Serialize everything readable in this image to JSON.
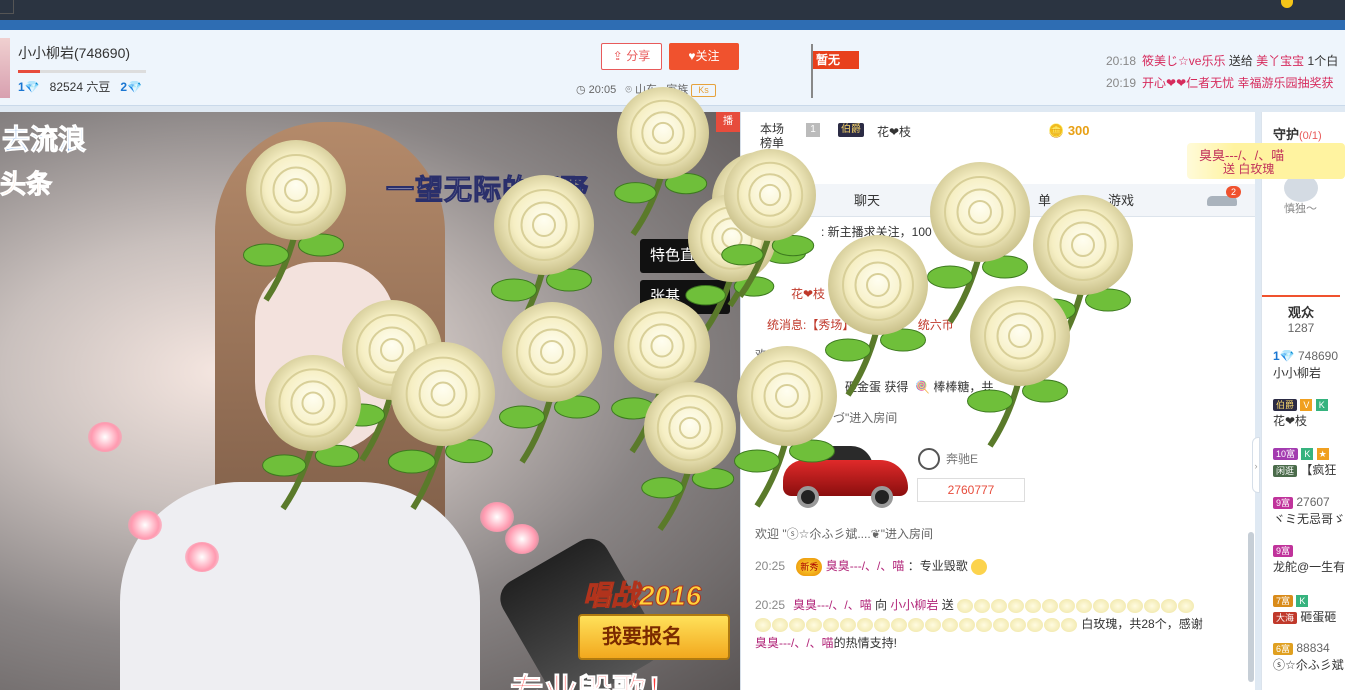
{
  "topnav": {
    "left_item1": "",
    "left_item2": "",
    "right_item": ""
  },
  "anchor": {
    "name": "小小柳岩(748690)",
    "level": "1",
    "beans": "82524 六豆",
    "next_level": "2"
  },
  "actions": {
    "share": "分享",
    "follow": "关注"
  },
  "meta": {
    "time": "20:05",
    "location": "山东",
    "family_label": "家族",
    "family_tag": "Ks"
  },
  "flag": {
    "label": "暂无"
  },
  "gift_feed": [
    {
      "time": "20:18",
      "from": "筱美じ☆ve乐乐",
      "verb": "送给",
      "to": "美丫宝宝",
      "gift": "1个白"
    },
    {
      "time": "20:19",
      "from": "开心❤❤仁者无忧",
      "verb": "",
      "to": "幸福游乐园抽奖获",
      "gift": ""
    }
  ],
  "video": {
    "song_prefix": "一望无际的",
    "song_blue": "原野",
    "tl_badge": "去流浪",
    "tl_badge2": "头条",
    "tag_special": "特色直播",
    "tag_other": "张基",
    "red_corner": "播",
    "changzhan": "唱战2016",
    "signup": "我要报名",
    "bottom_text": "专业毁歌！"
  },
  "rank": {
    "label": "本场榜单",
    "num": "1",
    "badge": "伯爵",
    "name": "花❤枝",
    "coins": "300"
  },
  "tabs": {
    "chat": "聊天",
    "list": "单",
    "game": "游戏",
    "badge": "2"
  },
  "chat": {
    "msg1": ": 新主播求关注，100",
    "msg2": "花❤枝",
    "msg3": "统消息:【秀场】",
    "msg3b": "统六币",
    "msg4": "欢迎",
    "msg5": "砸金蛋 获得",
    "msg5b": "棒棒糖，共",
    "msg6": "ゞづ\"进入房间",
    "car_brand": "奔驰E",
    "car_id": "2760777",
    "welcome": "欢迎 \"ⓢ☆尒ふ彡斌....❦\"进入房间",
    "m1_time": "20:25",
    "m1_user": "臭臭---/、/、喵",
    "m1_text": "：专业毁歌",
    "new_badge": "新秀",
    "m2_time": "20:25",
    "m2_user": "臭臭---/、/、喵",
    "m2_verb": "向",
    "m2_target": "小小柳岩",
    "m2_send": "送",
    "m2_gift": "白玫瑰，共28个，感谢",
    "m2_user2": "臭臭---/、/、喵",
    "m2_tail": "的热情支持!"
  },
  "right": {
    "guard_label": "守护",
    "guard_count": "(0/1)",
    "guard_name": "慎独～",
    "audience_label": "观众",
    "audience_count": "1287",
    "items": [
      {
        "badge": "1",
        "num": "748690",
        "name": "小小柳岩"
      },
      {
        "badge": "伯爵",
        "extra": "V",
        "name": "花❤枝"
      },
      {
        "badge": "10富",
        "tag": "闲逛",
        "name": "【疯狂"
      },
      {
        "badge": "9富",
        "num": "27607",
        "name": "ヾミ无忌哥ゞ"
      },
      {
        "badge": "9富",
        "name": "龙舵@一生有"
      },
      {
        "badge": "7富",
        "tag": "大海",
        "name": "砸蛋砸"
      },
      {
        "badge": "6富",
        "num": "88834",
        "name": "ⓢ☆尒ふ彡斌"
      }
    ]
  },
  "gift_popup": {
    "name": "臭臭---/、/、喵",
    "gift": "送 白玫瑰"
  }
}
